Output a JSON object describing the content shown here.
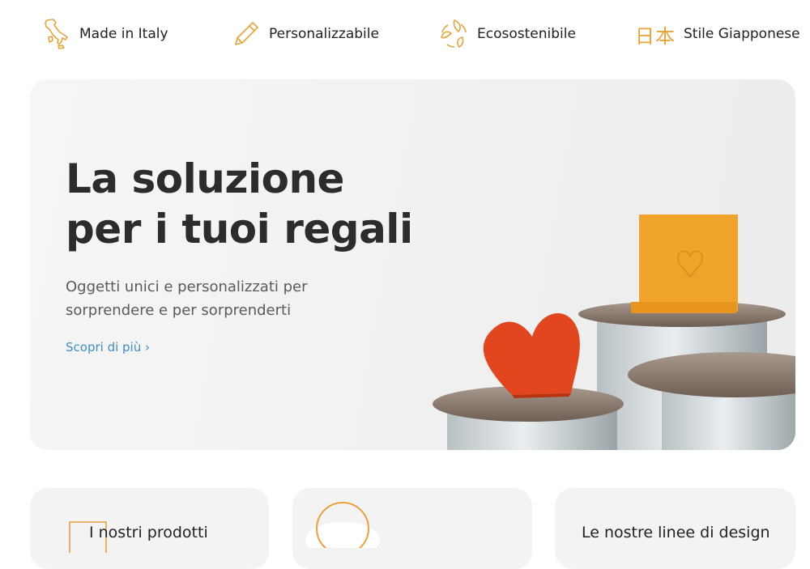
{
  "features": [
    {
      "icon": "italy-map-icon",
      "label": "Made in Italy"
    },
    {
      "icon": "pencil-icon",
      "label": "Personalizzabile"
    },
    {
      "icon": "leaf-recycle-icon",
      "label": "Ecosostenibile"
    },
    {
      "icon": "kanji-icon",
      "glyph": "日本",
      "label": "Stile Giapponese"
    }
  ],
  "hero": {
    "title_line1": "La soluzione",
    "title_line2": "per i tuoi regali",
    "subtitle_line1": "Oggetti unici e personalizzati per",
    "subtitle_line2": "sorprendere e per sorprenderti",
    "link": "Scopri di più ›"
  },
  "cards": [
    {
      "title": "I nostri prodotti"
    },
    {
      "title": ""
    },
    {
      "title": "Le nostre linee di design"
    }
  ],
  "colors": {
    "accent": "#e8a33b",
    "link": "#3f8fc4",
    "heart": "#e2461f",
    "card_bg": "#f3f3f4"
  }
}
